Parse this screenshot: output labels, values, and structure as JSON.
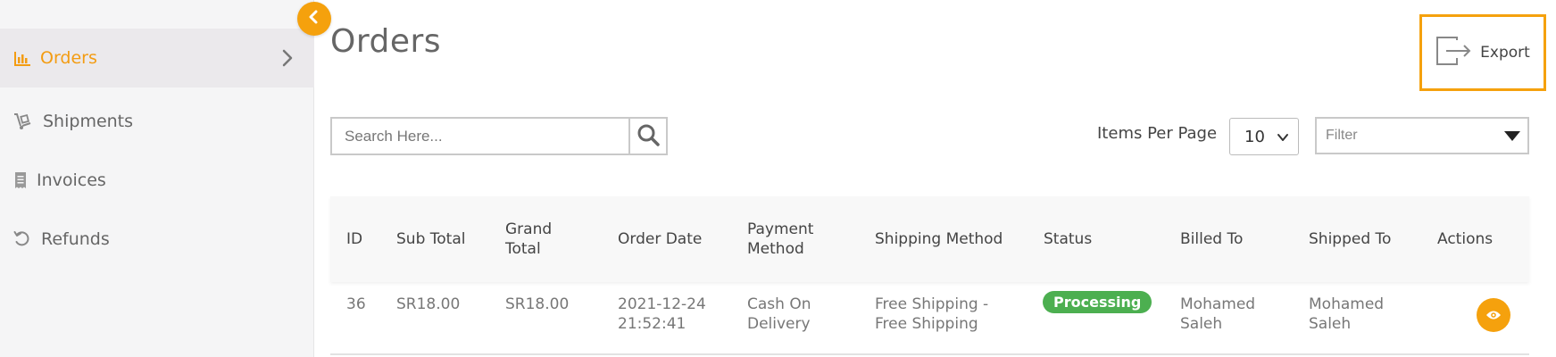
{
  "sidebar": {
    "items": [
      {
        "label": "Orders",
        "icon": "chart-icon",
        "active": true
      },
      {
        "label": "Shipments",
        "icon": "dolly-icon"
      },
      {
        "label": "Invoices",
        "icon": "receipt-icon"
      },
      {
        "label": "Refunds",
        "icon": "undo-icon"
      }
    ]
  },
  "header": {
    "title": "Orders",
    "export_label": "Export"
  },
  "toolbar": {
    "search_placeholder": "Search Here...",
    "items_per_page_label": "Items Per Page",
    "items_per_page_value": "10",
    "filter_placeholder": "Filter"
  },
  "table": {
    "columns": [
      "ID",
      "Sub Total",
      "Grand Total",
      "Order Date",
      "Payment Method",
      "Shipping Method",
      "Status",
      "Billed To",
      "Shipped To",
      "Actions"
    ],
    "rows": [
      {
        "id": "36",
        "sub_total": "SR18.00",
        "grand_total": "SR18.00",
        "order_date": "2021-12-24 21:52:41",
        "payment_method": "Cash On Delivery",
        "shipping_method": "Free Shipping - Free Shipping",
        "status": "Processing",
        "billed_to": "Mohamed Saleh",
        "shipped_to": "Mohamed Saleh"
      }
    ]
  },
  "colors": {
    "accent": "#f5a10d",
    "status_processing": "#4caf50"
  }
}
